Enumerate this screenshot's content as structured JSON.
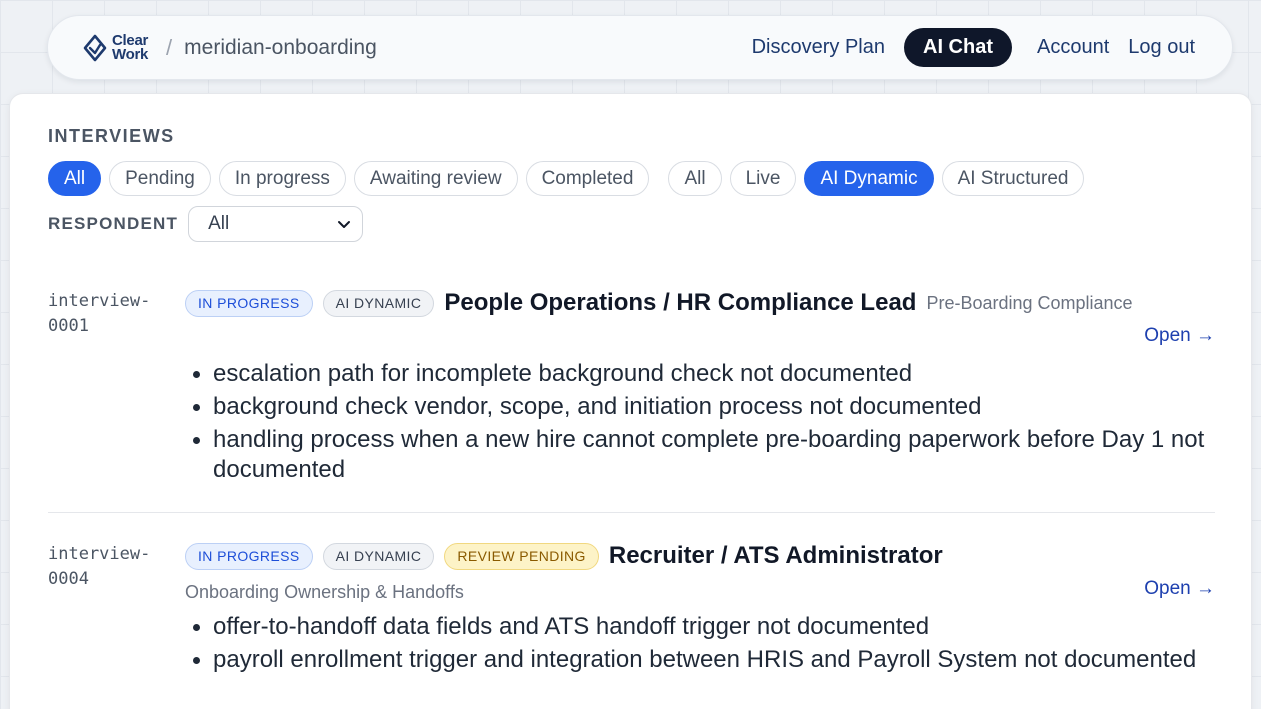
{
  "header": {
    "logo_line1": "Clear",
    "logo_line2": "Work",
    "separator": "/",
    "project": "meridian-onboarding",
    "nav": {
      "discovery": "Discovery Plan",
      "ai_chat": "AI Chat",
      "account": "Account",
      "logout": "Log out"
    }
  },
  "section_title": "INTERVIEWS",
  "status_filters": [
    "All",
    "Pending",
    "In progress",
    "Awaiting review",
    "Completed"
  ],
  "type_filters": [
    "All",
    "Live",
    "AI Dynamic",
    "AI Structured"
  ],
  "active_status_filter": "All",
  "active_type_filter": "AI Dynamic",
  "respondent": {
    "label": "RESPONDENT",
    "selected": "All"
  },
  "interviews": [
    {
      "id_line1": "interview-",
      "id_line2": "0001",
      "badges": [
        "IN PROGRESS",
        "AI DYNAMIC"
      ],
      "title": "People Operations / HR Compliance Lead",
      "subtitle": "Pre-Boarding Compliance",
      "open": "Open →",
      "gaps": [
        "escalation path for incomplete background check not documented",
        "background check vendor, scope, and initiation process not documented",
        "handling process when a new hire cannot complete pre-boarding paperwork before Day 1 not documented"
      ]
    },
    {
      "id_line1": "interview-",
      "id_line2": "0004",
      "badges": [
        "IN PROGRESS",
        "AI DYNAMIC",
        "REVIEW PENDING"
      ],
      "title": "Recruiter / ATS Administrator",
      "subtitle": "Onboarding Ownership & Handoffs",
      "open": "Open →",
      "gaps": [
        "offer-to-handoff data fields and ATS handoff trigger not documented",
        "payroll enrollment trigger and integration between HRIS and Payroll System not documented"
      ]
    }
  ],
  "colors": {
    "accent": "#2563eb",
    "nav_dark": "#0f172a",
    "link": "#1e3a6e"
  }
}
